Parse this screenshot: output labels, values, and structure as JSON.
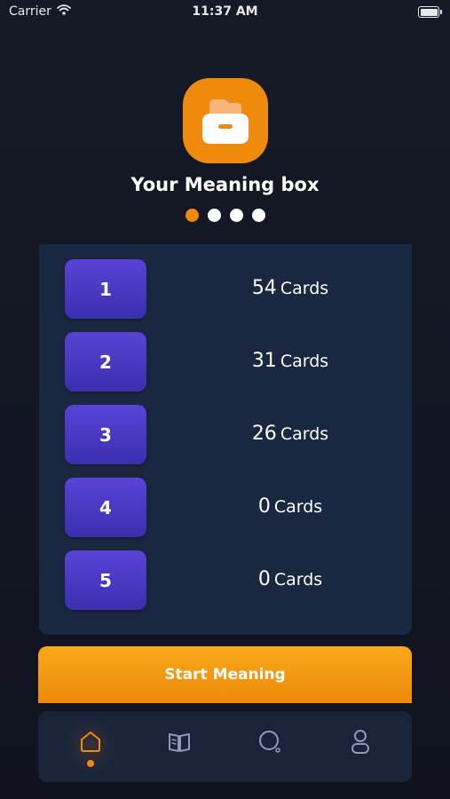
{
  "status_bar": {
    "carrier": "Carrier",
    "time": "11:37 AM",
    "icons": [
      "wifi-icon",
      "battery-icon"
    ]
  },
  "header": {
    "icon": "drawer-box-icon",
    "title": "Your Meaning box",
    "page_indicator": {
      "count": 4,
      "active_index": 0
    }
  },
  "boxes": [
    {
      "label": "1",
      "count": "54",
      "unit": "Cards"
    },
    {
      "label": "2",
      "count": "31",
      "unit": "Cards"
    },
    {
      "label": "3",
      "count": "26",
      "unit": "Cards"
    },
    {
      "label": "4",
      "count": "0",
      "unit": "Cards"
    },
    {
      "label": "5",
      "count": "0",
      "unit": "Cards"
    }
  ],
  "start_button": {
    "label": "Start Meaning"
  },
  "tab_bar": {
    "tabs": [
      {
        "icon": "home-icon",
        "active": true
      },
      {
        "icon": "book-icon",
        "active": false
      },
      {
        "icon": "search-icon",
        "active": false
      },
      {
        "icon": "profile-icon",
        "active": false
      }
    ]
  },
  "colors": {
    "accent": "#f08a0c",
    "background": "#131722",
    "panel": "#1a2740",
    "box_button": "#4a39c8",
    "tab_inactive": "#8f9bb3"
  }
}
